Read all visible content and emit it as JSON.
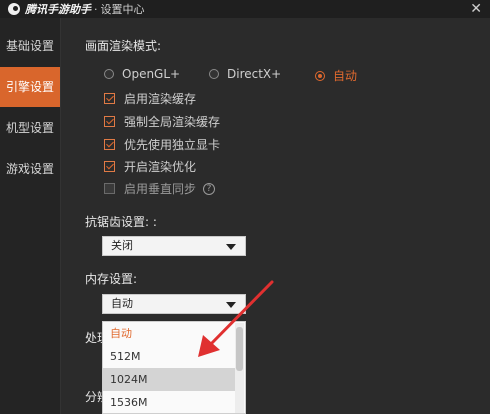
{
  "window": {
    "brand": "腾讯手游助手",
    "separator": "·",
    "subtitle": "设置中心",
    "close_glyph": "✕"
  },
  "sidebar": {
    "items": [
      {
        "label": "基础设置",
        "active": false
      },
      {
        "label": "引擎设置",
        "active": true
      },
      {
        "label": "机型设置",
        "active": false
      },
      {
        "label": "游戏设置",
        "active": false
      }
    ]
  },
  "render": {
    "label": "画面渲染模式:",
    "options": [
      {
        "label": "OpenGL+",
        "checked": false
      },
      {
        "label": "DirectX+",
        "checked": false
      },
      {
        "label": "自动",
        "checked": true
      }
    ],
    "checkboxes": [
      {
        "label": "启用渲染缓存",
        "checked": true
      },
      {
        "label": "强制全局渲染缓存",
        "checked": true
      },
      {
        "label": "优先使用独立显卡",
        "checked": true
      },
      {
        "label": "开启渲染优化",
        "checked": true
      },
      {
        "label": "启用垂直同步",
        "checked": false
      }
    ],
    "help_glyph": "?"
  },
  "antialias": {
    "label": "抗锯齿设置: :",
    "value": "关闭"
  },
  "memory": {
    "label": "内存设置:",
    "value": "自动",
    "options": [
      "自动",
      "512M",
      "1024M",
      "1536M"
    ],
    "selected_index": 0,
    "hover_index": 2
  },
  "partial_labels": {
    "processor": "处理",
    "resolution": "分辨"
  },
  "colors": {
    "accent": "#e0692e",
    "background": "#2b2b2b",
    "sidebar": "#242424",
    "annotation_arrow": "#e03030"
  },
  "icons": {
    "logo": "tencent-logo-icon",
    "close": "close-icon",
    "help": "help-icon",
    "caret": "chevron-down-icon",
    "annotation": "red-arrow-annotation"
  }
}
